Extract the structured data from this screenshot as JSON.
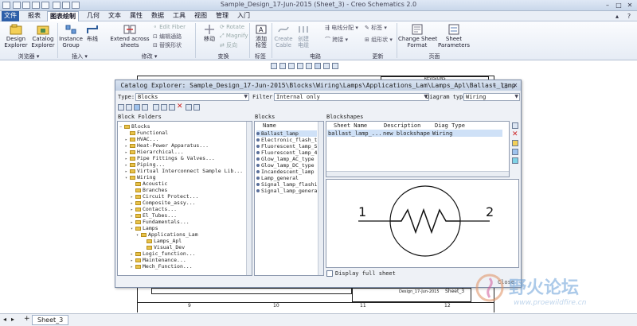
{
  "app": {
    "title": "Sample_Design_17-Jun-2015 (Sheet_3) - Creo Schematics 2.0",
    "window_controls": [
      "–",
      "□",
      "✕"
    ]
  },
  "menu": {
    "tabs": [
      "文件",
      "报表",
      "图表绘制",
      "几何",
      "文本",
      "属性",
      "数据",
      "工具",
      "视图",
      "管理",
      "入门"
    ],
    "active": "图表绘制"
  },
  "ribbon": {
    "design_explorer": "Design\nExplorer",
    "catalog_explorer": "Catalog\nExplorer",
    "instance_group": "Instance\nGroup",
    "line": "布线",
    "extend_across": "Extend across\nsheets",
    "edit_fiber": "Edit Fiber",
    "edit_path": "编辑通路",
    "replace_shape": "替换形状",
    "move": "移动",
    "rotate": "Rotate",
    "magnify": "Magnify",
    "reverse": "反向",
    "add_label": "添加\n标签",
    "create_cable": "Create\nCable",
    "create_conductor": "创建\n电缆",
    "wire_distribution": "电线分配",
    "jump": "跨接",
    "tag": "标签",
    "tube_shape": "组形状",
    "change_sheet_format": "Change Sheet\nFormat",
    "sheet_parameters": "Sheet\nParameters",
    "groups": {
      "browser": "浏览器",
      "insert": "插入",
      "modify": "修改",
      "transform": "变换",
      "label": "标签",
      "circuit": "电路",
      "update": "更新",
      "page": "页面"
    }
  },
  "drawing": {
    "revisions_label": "REVISIONS",
    "col_nums": [
      "9",
      "10",
      "11",
      "12"
    ],
    "sheet_label": "Sheet_3",
    "design_label": "Design_17-Jun-2015"
  },
  "dialog": {
    "title": "Catalog Explorer: Sample_Design_17-Jun-2015\\Blocks\\Wiring\\Lamps\\Applications_Lam\\Lamps_Apl\\Ballast_lamp",
    "type_label": "Type:",
    "type_value": "Blocks",
    "filter_label": "Filter:",
    "filter_value": "Internal only",
    "diagram_type_label": "Diagram type:",
    "diagram_type_value": "Wiring",
    "block_folders_label": "Block Folders",
    "blocks_label": "Blocks",
    "blockshapes_label": "Blockshapes",
    "name_col": "Name",
    "shape_cols": [
      "Sheet Name",
      "Description",
      "Diag Type"
    ],
    "shape_row": [
      "ballast_lamp_...",
      "new blockshape",
      "Wiring"
    ],
    "display_full_sheet": "Display full sheet",
    "close": "Close",
    "pin_labels": [
      "1",
      "2"
    ],
    "folders": [
      {
        "label": "Blocks",
        "expand": "−",
        "level": 0
      },
      {
        "label": "Functional",
        "expand": "",
        "level": 1
      },
      {
        "label": "HVAC...",
        "expand": "▸",
        "level": 1
      },
      {
        "label": "Heat-Power Apparatus...",
        "expand": "▸",
        "level": 1
      },
      {
        "label": "Hierarchical...",
        "expand": "▸",
        "level": 1
      },
      {
        "label": "Pipe Fittings & Valves...",
        "expand": "▸",
        "level": 1
      },
      {
        "label": "Piping...",
        "expand": "▸",
        "level": 1
      },
      {
        "label": "Virtual Interconnect Sample Lib...",
        "expand": "▸",
        "level": 1
      },
      {
        "label": "Wiring",
        "expand": "▾",
        "level": 1
      },
      {
        "label": "Acoustic",
        "expand": "",
        "level": 2
      },
      {
        "label": "Branches",
        "expand": "",
        "level": 2
      },
      {
        "label": "Circuit Protect...",
        "expand": "▸",
        "level": 2
      },
      {
        "label": "Composite_assy...",
        "expand": "▸",
        "level": 2
      },
      {
        "label": "Contacts...",
        "expand": "▸",
        "level": 2
      },
      {
        "label": "El_Tubes...",
        "expand": "▸",
        "level": 2
      },
      {
        "label": "Fundamentals...",
        "expand": "▸",
        "level": 2
      },
      {
        "label": "Lamps",
        "expand": "▾",
        "level": 2
      },
      {
        "label": "Applications_Lam",
        "expand": "▾",
        "level": 3
      },
      {
        "label": "Lamps_Apl",
        "expand": "",
        "level": 4
      },
      {
        "label": "Visual_Dev",
        "expand": "",
        "level": 4
      },
      {
        "label": "Logic_function...",
        "expand": "▸",
        "level": 2
      },
      {
        "label": "Maintenance...",
        "expand": "▸",
        "level": 2
      },
      {
        "label": "Mech_Function...",
        "expand": "▸",
        "level": 2
      }
    ],
    "blocks": [
      "Ballast_lamp",
      "Electronic_flash_t",
      "Fluorescent_lamp_S",
      "Fluorescent_lamp_4",
      "Glow_lamp_AC_type",
      "Glow_lamp_DC_type",
      "Incandescent_lamp",
      "Lamp_general",
      "Signal_lamp_flashi",
      "Signal_lamp_genera"
    ],
    "selected_block": "Ballast_lamp"
  },
  "bottom": {
    "sheet_tab": "Sheet_3",
    "nav": [
      "◂",
      "▸",
      "+"
    ]
  },
  "watermark": {
    "cn": "野火论坛",
    "url": "www.proewildfire.cn"
  }
}
